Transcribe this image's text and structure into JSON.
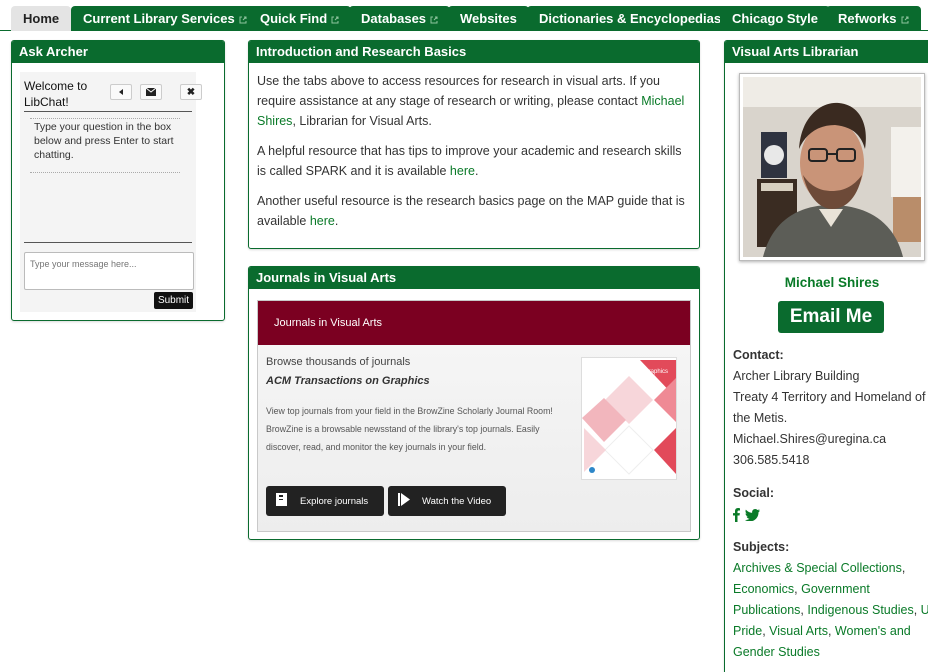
{
  "tabs": [
    {
      "label": "Home",
      "external": false,
      "active": true
    },
    {
      "label": "Current Library Services",
      "external": true
    },
    {
      "label": "Quick Find",
      "external": true
    },
    {
      "label": "Databases",
      "external": true
    },
    {
      "label": "Websites",
      "external": false
    },
    {
      "label": "Dictionaries & Encyclopedias",
      "external": false
    },
    {
      "label": "Chicago Style",
      "external": false
    },
    {
      "label": "Refworks",
      "external": true
    }
  ],
  "ask_archer": {
    "title": "Ask Archer",
    "welcome": "Welcome to LibChat!",
    "prompt": "Type your question in the box below and press Enter to start chatting.",
    "input_placeholder": "Type your message here...",
    "submit_label": "Submit",
    "icons": [
      "volume-icon",
      "email-icon",
      "close-icon"
    ]
  },
  "intro": {
    "title": "Introduction and Research Basics",
    "p1_before": "Use the tabs above to access resources for research in visual arts.  If you require assistance at any stage of research or writing, please contact ",
    "p1_link": "Michael Shires",
    "p1_after": ", Librarian for Visual Arts.",
    "p2_before": "A helpful resource that has tips to improve your academic and research skills is called SPARK and it is available ",
    "p2_link": "here",
    "p2_after": ".",
    "p3_before": "Another useful resource is the research basics page on the MAP guide that is available ",
    "p3_link": "here",
    "p3_after": "."
  },
  "journals": {
    "title": "Journals in Visual Arts",
    "widget_title": "Journals in Visual Arts",
    "browse": "Browse thousands of journals",
    "featured_journal": "ACM Transactions on Graphics",
    "description": "View top journals from your field in the BrowZine Scholarly Journal Room! BrowZine is a browsable newsstand of the library's top journals. Easily discover, read, and monitor the key journals in your field.",
    "explore_label": "Explore journals",
    "video_label": "Watch the Video",
    "cover_title": "Graphics"
  },
  "librarian": {
    "title": "Visual Arts Librarian",
    "name": "Michael Shires",
    "email_button": "Email Me",
    "contact_label": "Contact:",
    "contact_lines": [
      "Archer Library Building",
      "Treaty 4 Territory and Homeland of the Metis.",
      "Michael.Shires@uregina.ca",
      "306.585.5418"
    ],
    "social_label": "Social:",
    "subjects_label": "Subjects:",
    "subjects": [
      "Archives & Special Collections",
      "Economics",
      "Government Publications",
      "Indigenous Studies",
      "UR Pride",
      "Visual Arts",
      "Women's and Gender Studies"
    ]
  },
  "colors": {
    "brand_green": "#0a6b2e",
    "link_green": "#0a7a28",
    "widget_maroon": "#7b0021"
  }
}
